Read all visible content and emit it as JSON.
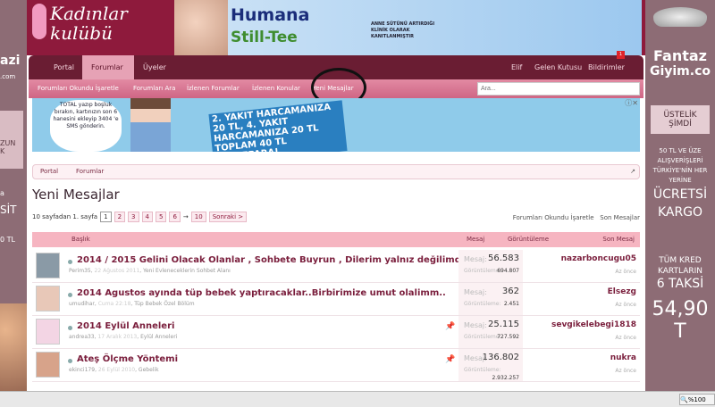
{
  "left_ad": {
    "line1": "azi",
    "line2": ".com",
    "box1": "ZUN\nK",
    "l3": "a",
    "l4": "SİT",
    "l5": "0 TL"
  },
  "right_ad": {
    "brand1": "Fantaz",
    "brand2": "Giyim.co",
    "box": "ÜSTELİK ŞİMDİ",
    "promo1": "50 TL VE ÜZE ALIŞVERİŞLERİ TÜRKİYE'NİN HER YERİNE",
    "promo2": "ÜCRETSİ KARGO",
    "promo3": "TÜM KRED KARTLARIN",
    "promo4": "6 TAKSİ",
    "price": "54,90 T"
  },
  "logo": {
    "line1": "Kadınlar",
    "line2": "kulübü"
  },
  "banner": {
    "brand": "Humana",
    "product": "Still-Tee",
    "claim": "ANNE SÜTÜNÜ ARTIRDIĞI KLİNİK OLARAK KANITLANMIŞTIR"
  },
  "nav": {
    "tabs": [
      {
        "label": "Portal"
      },
      {
        "label": "Forumlar"
      },
      {
        "label": "Üyeler"
      }
    ],
    "active": "Forumlar",
    "user": "Elif",
    "inbox": "Gelen Kutusu",
    "alerts": "Bildirimler",
    "alerts_count": "1"
  },
  "subnav": {
    "items": [
      "Forumları Okundu İşaretle",
      "Forumları Ara",
      "İzlenen Forumlar",
      "İzlenen Konular",
      "Yeni Mesajlar"
    ],
    "search_placeholder": "Ara..."
  },
  "ad2": {
    "bubble": "TOTAL yazıp boşluk bırakın, kartınızın son 6 hanesini ekleyip 3404 'e SMS gönderin.",
    "slogan": "2. YAKIT HARCAMANIZA 20 TL, 4. YAKIT HARCAMANIZA 20 TL TOPLAM 40 TL PARAFPARA!"
  },
  "breadcrumb": [
    "Portal",
    "Forumlar"
  ],
  "page_title": "Yeni Mesajlar",
  "pager": {
    "label": "10 sayfadan 1. sayfa",
    "pages": [
      "1",
      "2",
      "3",
      "4",
      "5",
      "6"
    ],
    "ellipsis": "→",
    "last": "10",
    "next": "Sonraki >",
    "current": "1"
  },
  "right_links": [
    "Forumları Okundu İşaretle",
    "Son Mesajlar"
  ],
  "table": {
    "headers": {
      "title": "Başlık",
      "messages": "Mesaj",
      "views": "Görüntüleme",
      "last": "Son Mesaj"
    },
    "mesaj_label": "Mesaj:",
    "views_label": "Görüntüleme:",
    "rows": [
      {
        "title": "2014 / 2015 Gelini Olacak Olanlar , Sohbete Buyrun , Dilerim yalnız değilimdir....",
        "author": "Perim35",
        "date": "22 Ağustos 2011",
        "forum": "Yeni Evleneceklerin Sohbet Alanı",
        "messages": "56.583",
        "views": "694.807",
        "last_user": "nazarboncugu05",
        "last_time": "Az önce",
        "sticky": false
      },
      {
        "title": "2014 Agustos ayında tüp bebek yaptıracaklar..Birbirimize umut olalimm..",
        "author": "umudihar",
        "date": "Cuma 22:18",
        "forum": "Tüp Bebek Özel Bölüm",
        "messages": "362",
        "views": "2.451",
        "last_user": "Elsezg",
        "last_time": "Az önce",
        "sticky": false
      },
      {
        "title": "2014 Eylül Anneleri",
        "author": "andrea33",
        "date": "17 Aralık 2013",
        "forum": "Eylül Anneleri",
        "messages": "25.115",
        "views": "727.592",
        "last_user": "sevgikelebegi1818",
        "last_time": "Az önce",
        "sticky": true
      },
      {
        "title": "Ateş Ölçme Yöntemi",
        "author": "ekinci179",
        "date": "26 Eylül 2010",
        "forum": "Gebelik",
        "messages": "136.802",
        "views": "2.932.257",
        "last_user": "nukra",
        "last_time": "Az önce",
        "sticky": true
      }
    ]
  },
  "status_zoom": "%100"
}
